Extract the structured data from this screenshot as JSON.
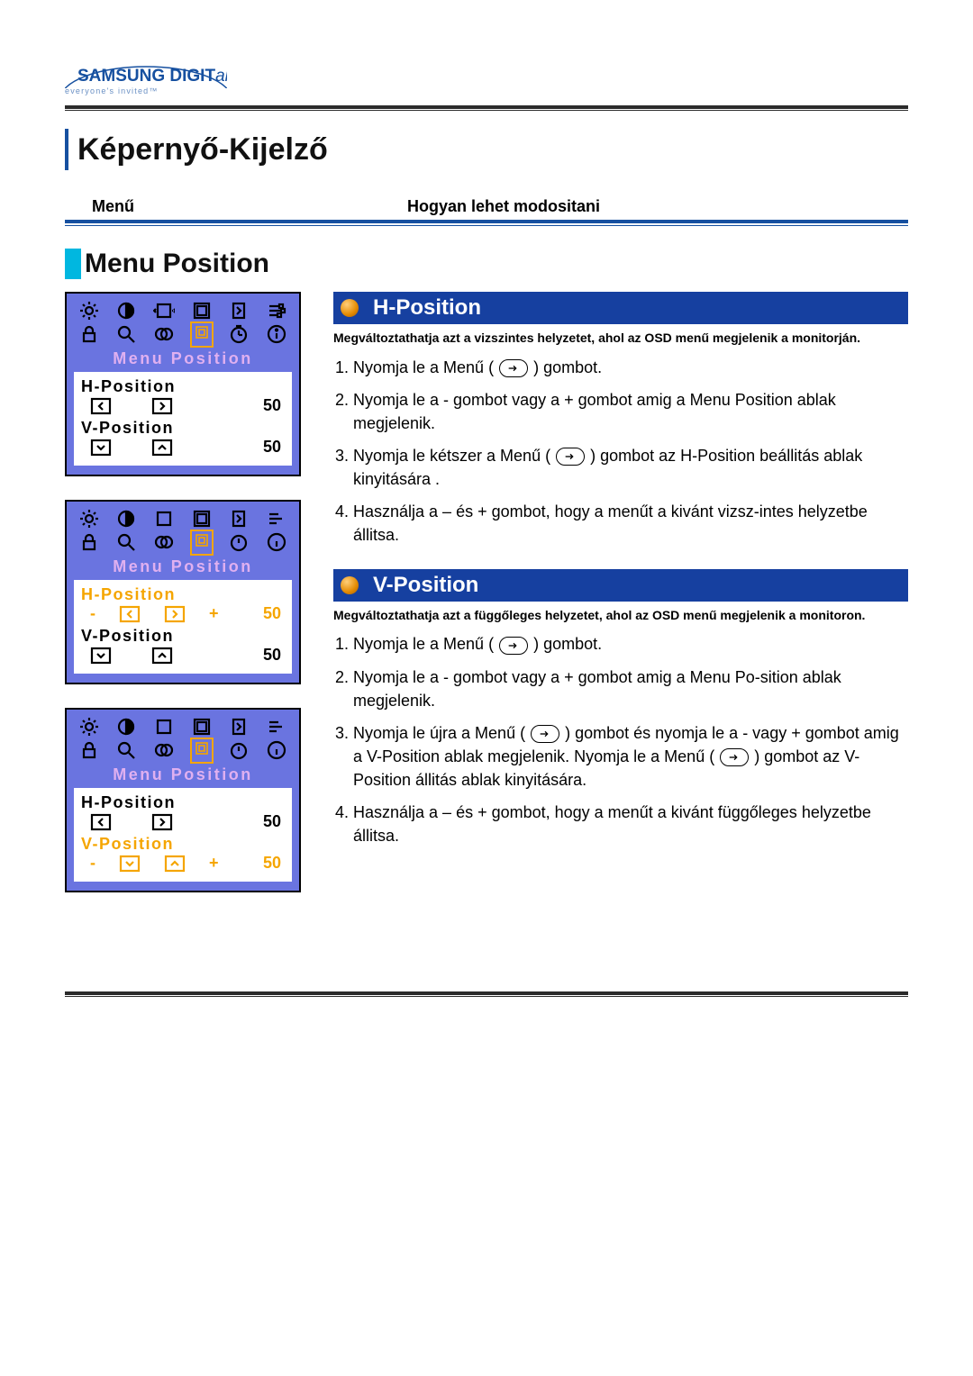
{
  "logo": {
    "brand": "SAMSUNG DIGITall",
    "tagline": "everyone's invited™"
  },
  "page_title": "Képernyő-Kijelző",
  "columns": {
    "left": "Menű",
    "right": "Hogyan lehet modositani"
  },
  "section_title": "Menu Position",
  "osd": {
    "title": "Menu Position",
    "panels": [
      {
        "h_label": "H-Position",
        "h_val": "50",
        "h_active": false,
        "v_label": "V-Position",
        "v_val": "50",
        "v_active": false
      },
      {
        "h_label": "H-Position",
        "h_val": "50",
        "h_active": true,
        "v_label": "V-Position",
        "v_val": "50",
        "v_active": false
      },
      {
        "h_label": "H-Position",
        "h_val": "50",
        "h_active": false,
        "v_label": "V-Position",
        "v_val": "50",
        "v_active": true
      }
    ]
  },
  "hpos": {
    "heading": "H-Position",
    "desc": "Megváltoztathatja azt a vizszintes helyzetet, ahol az OSD menű megjelenik a monitorján.",
    "steps": {
      "s1a": "Nyomja le a Menű  ( ",
      "s1b": " ) gombot.",
      "s2": "Nyomja le a - gombot vagy a + gombot amig a Menu Position ablak megjelenik.",
      "s3a": "Nyomja le kétszer a Menű ( ",
      "s3b": " ) gombot az H-Position beállitás ablak kinyitására .",
      "s4": "Használja a – és + gombot, hogy a menűt a kivánt vizsz-intes helyzetbe állitsa."
    }
  },
  "vpos": {
    "heading": "V-Position",
    "desc": "Megváltoztathatja azt a függőleges helyzetet, ahol az OSD menű megjelenik a monitoron.",
    "steps": {
      "s1a": "Nyomja le a Menű  ( ",
      "s1b": " ) gombot.",
      "s2": "Nyomja le a - gombot vagy a + gombot amig a Menu Po-sition ablak megjelenik.",
      "s3a": "Nyomja le újra a Menű ( ",
      "s3b": " ) gombot és nyomja le a - vagy + gombot amig a V-Position ablak megjelenik. Nyomja le a Menű ( ",
      "s3c": " ) gombot az V-Position állitás ablak kinyitására.",
      "s4": "Használja a – és + gombot, hogy a menűt a kivánt függőleges helyzetbe állitsa."
    }
  }
}
